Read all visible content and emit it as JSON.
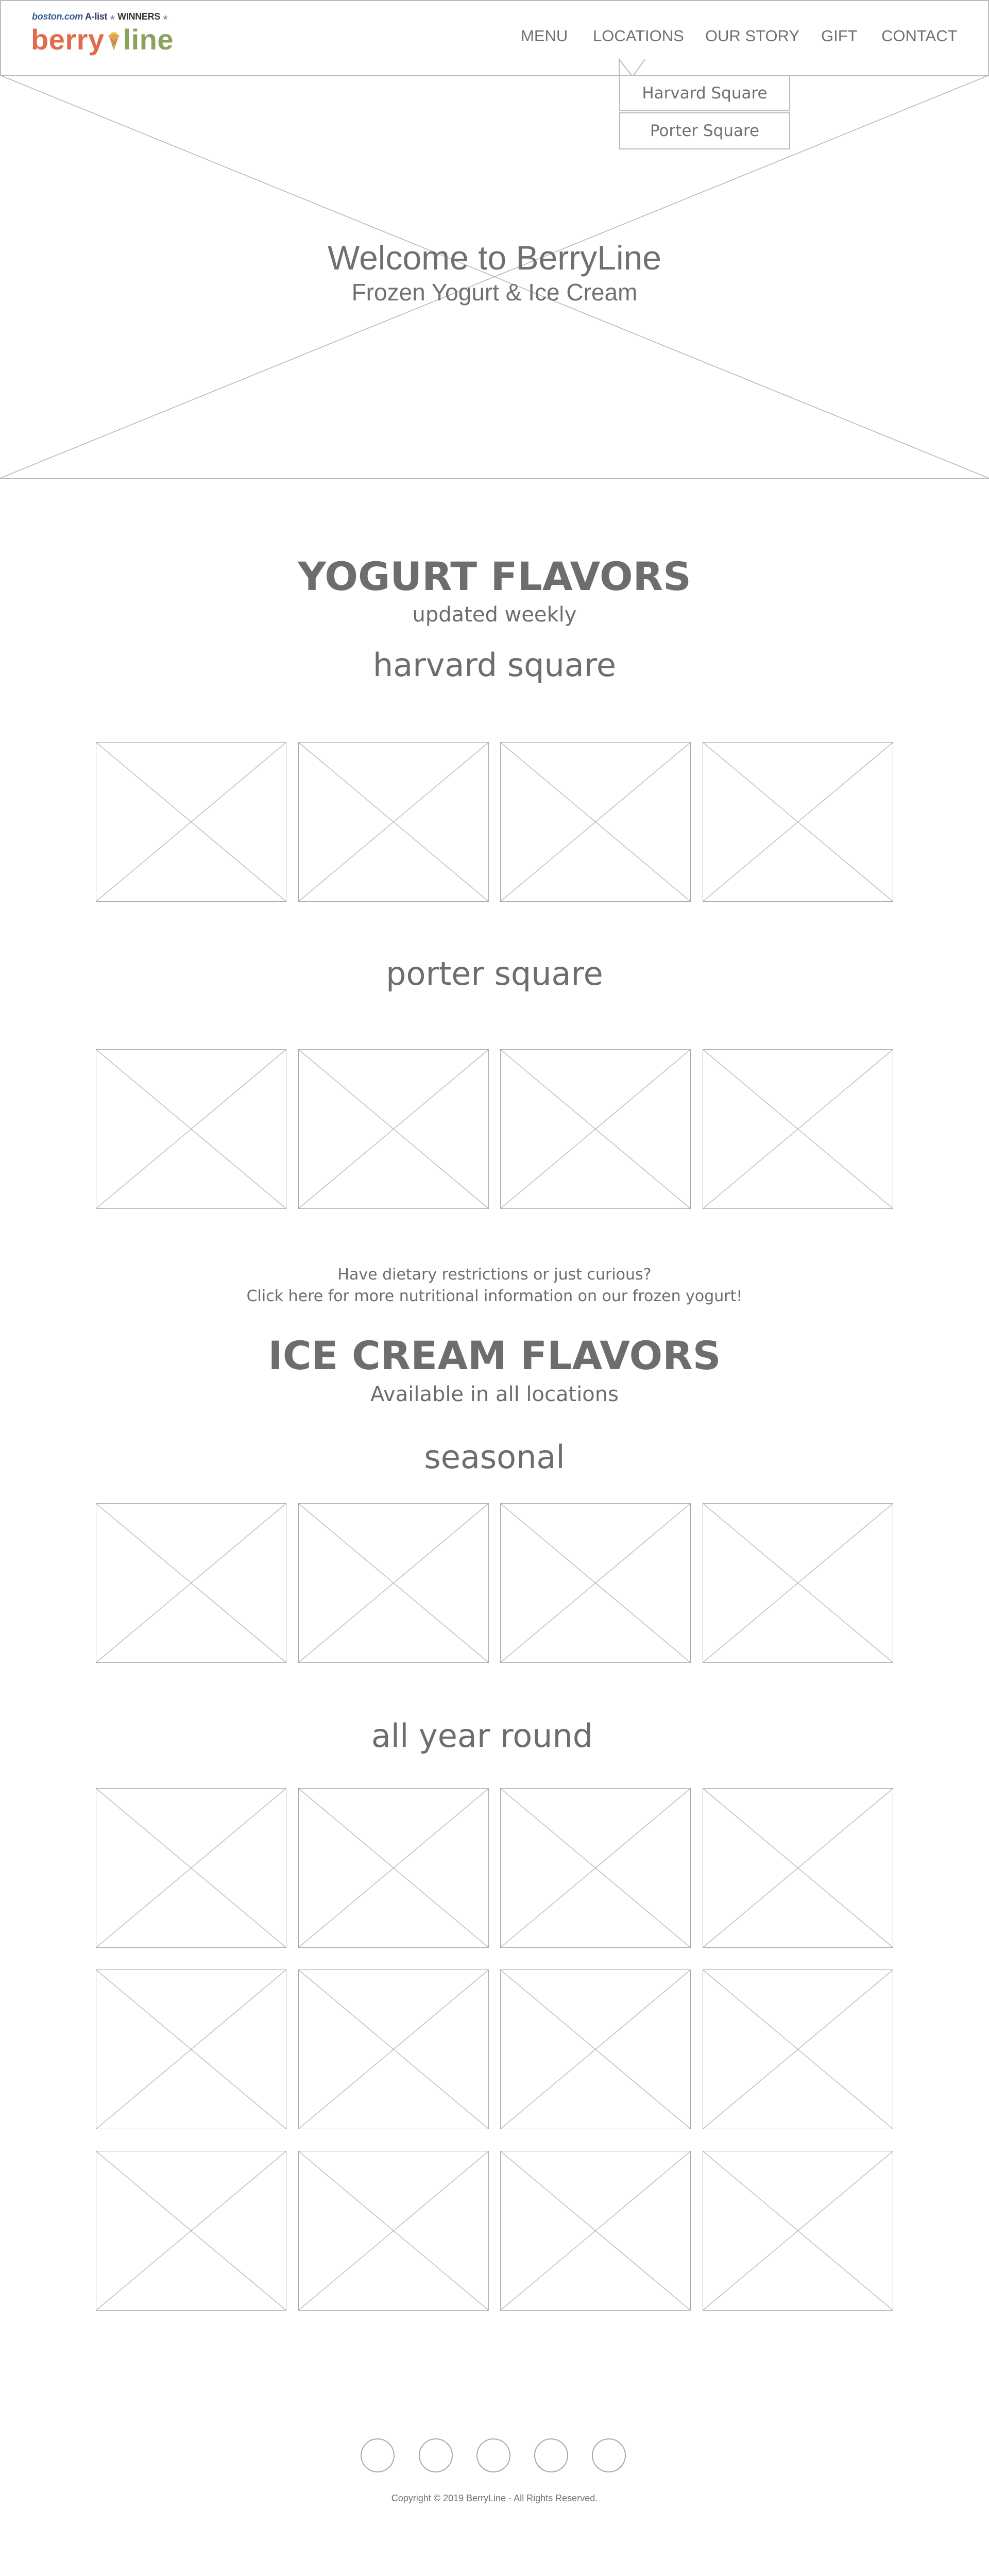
{
  "header": {
    "logo": {
      "award_prefix": "boston.com",
      "award_brand": "A-list",
      "award_label": "WINNERS",
      "brand_part1": "berry",
      "brand_part2": "line"
    },
    "nav": {
      "menu": "MENU",
      "locations": "LOCATIONS",
      "our_story": "OUR STORY",
      "gift": "GIFT",
      "contact": "CONTACT"
    },
    "locations_dropdown": [
      "Harvard Square",
      "Porter Square"
    ]
  },
  "hero": {
    "title": "Welcome to BerryLine",
    "subtitle": "Frozen Yogurt & Ice Cream"
  },
  "yogurt": {
    "title": "YOGURT FLAVORS",
    "subtitle": "updated weekly",
    "harvard_heading": "harvard square",
    "porter_heading": "porter square"
  },
  "info": {
    "line1": "Have dietary restrictions or just curious?",
    "line2": "Click here for more nutritional information on our frozen yogurt!"
  },
  "ice_cream": {
    "title": "ICE CREAM FLAVORS",
    "subtitle": "Available in all locations",
    "seasonal_heading": "seasonal",
    "all_year_heading": "all year round"
  },
  "footer": {
    "social_icons": [
      "social-icon-1",
      "social-icon-2",
      "social-icon-3",
      "social-icon-4",
      "social-icon-5"
    ],
    "copyright": "Copyright © 2019 BerryLine - All Rights Reserved."
  }
}
